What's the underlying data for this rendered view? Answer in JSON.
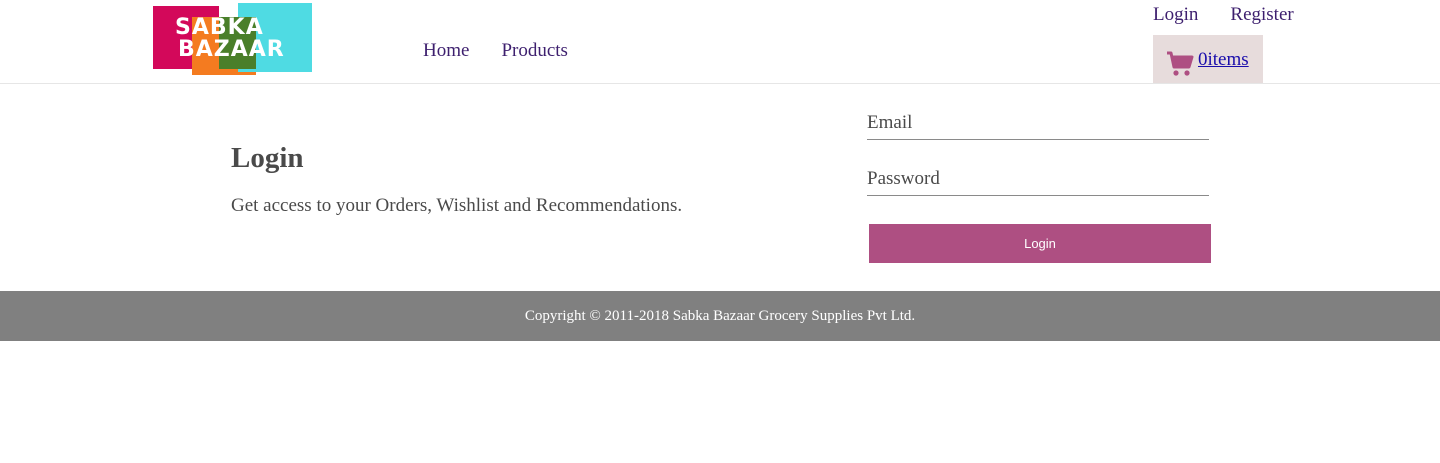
{
  "brand": {
    "logo_line1": "SABKA",
    "logo_line2": "BAZAAR",
    "colors": {
      "red": "#d3085a",
      "orange": "#f47b20",
      "green": "#4a7f2a",
      "cyan": "#4fdbe3"
    }
  },
  "nav": {
    "items": [
      {
        "label": "Home"
      },
      {
        "label": "Products"
      }
    ]
  },
  "auth": {
    "login_label": "Login",
    "register_label": "Register"
  },
  "cart": {
    "icon": "cart-icon",
    "count_label": "0items"
  },
  "login": {
    "title": "Login",
    "description": "Get access to your Orders, Wishlist and Recommendations.",
    "email_placeholder": "Email",
    "password_placeholder": "Password",
    "submit_label": "Login",
    "button_color": "#ae4f82"
  },
  "footer": {
    "copyright": "Copyright © 2011-2018 Sabka Bazaar Grocery Supplies Pvt Ltd."
  }
}
